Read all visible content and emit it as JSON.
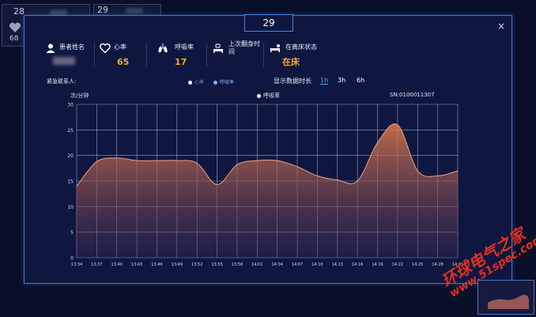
{
  "background_cards": [
    {
      "number": "28",
      "heart_value": "68"
    },
    {
      "number": "29"
    }
  ],
  "modal": {
    "room_number": "29",
    "close_glyph": "×",
    "stats": {
      "patient_name_label": "患者姓名",
      "heart_rate_label": "心率",
      "heart_rate_value": "65",
      "resp_rate_label": "呼吸率",
      "resp_rate_value": "17",
      "last_turn_label": "上次翻身时间",
      "bed_status_label": "在离床状态",
      "bed_status_value": "在床"
    },
    "emergency_contact_label": "紧急联系人:",
    "toggle": {
      "heart_label": "心率",
      "resp_label": "呼吸率"
    },
    "duration_label": "显示数据时长",
    "durations": [
      "1h",
      "3h",
      "6h"
    ],
    "active_duration": "1h",
    "sn": "SN:0100011307"
  },
  "colors": {
    "accent_orange": "#f5a82a",
    "active_blue": "#4da3ff",
    "modal_bg": "#0f1740",
    "area_top": "#e07a4c"
  },
  "icons": [
    "user-icon",
    "heart-icon",
    "lungs-icon",
    "bed-turn-icon",
    "bed-status-icon",
    "close-icon"
  ],
  "watermark": {
    "line1": "环球电气之家",
    "line2": "www.51spec.com"
  },
  "chart_data": {
    "type": "area",
    "ylabel": "次/分钟",
    "legend": "呼吸率",
    "ylim": [
      0,
      30
    ],
    "yticks": [
      0,
      5,
      10,
      15,
      20,
      25,
      30
    ],
    "grid": true,
    "x": [
      "13:34",
      "13:37",
      "13:40",
      "13:43",
      "13:46",
      "13:49",
      "13:52",
      "13:55",
      "13:58",
      "14:01",
      "14:04",
      "14:07",
      "14:10",
      "14:13",
      "14:16",
      "14:19",
      "14:22",
      "14:25",
      "14:28",
      "14:31"
    ],
    "series": [
      {
        "name": "呼吸率",
        "values": [
          14,
          18.8,
          19.5,
          19,
          19,
          19,
          18.5,
          14.3,
          18.2,
          19,
          19,
          17.8,
          16,
          15.2,
          15,
          22.5,
          26,
          17,
          16,
          17
        ]
      }
    ]
  }
}
